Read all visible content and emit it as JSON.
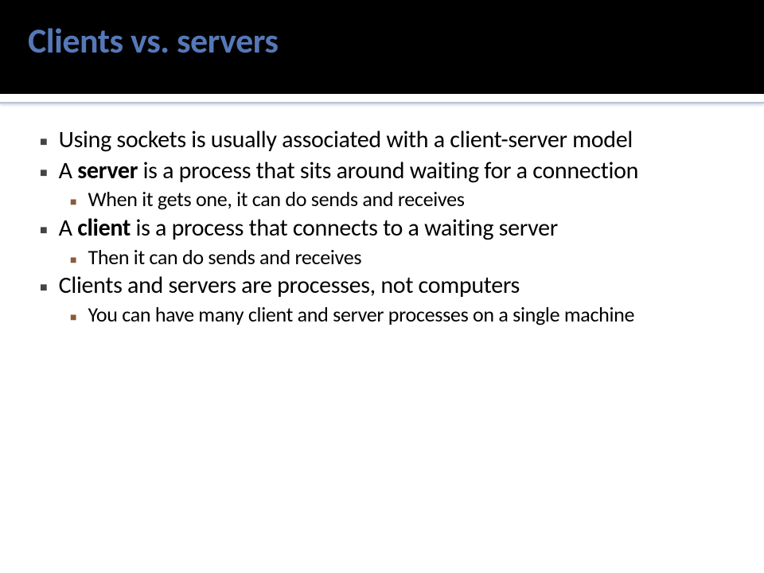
{
  "slide": {
    "title": "Clients vs. servers",
    "bullets": [
      {
        "level": 1,
        "segments": [
          {
            "text": "Using sockets is usually associated with a client-server model",
            "bold": false
          }
        ]
      },
      {
        "level": 1,
        "segments": [
          {
            "text": "A ",
            "bold": false
          },
          {
            "text": "server",
            "bold": true
          },
          {
            "text": " is a process that sits around waiting for a connection",
            "bold": false
          }
        ]
      },
      {
        "level": 2,
        "segments": [
          {
            "text": "When it gets one, it can do sends and receives",
            "bold": false
          }
        ]
      },
      {
        "level": 1,
        "segments": [
          {
            "text": "A ",
            "bold": false
          },
          {
            "text": "client",
            "bold": true
          },
          {
            "text": " is a process that connects to a waiting server",
            "bold": false
          }
        ]
      },
      {
        "level": 2,
        "segments": [
          {
            "text": "Then it can do sends and receives",
            "bold": false
          }
        ]
      },
      {
        "level": 1,
        "segments": [
          {
            "text": "Clients and servers are processes, not computers",
            "bold": false
          }
        ]
      },
      {
        "level": 2,
        "segments": [
          {
            "text": "You can have many client and server processes on a single machine",
            "bold": false
          }
        ]
      }
    ]
  }
}
